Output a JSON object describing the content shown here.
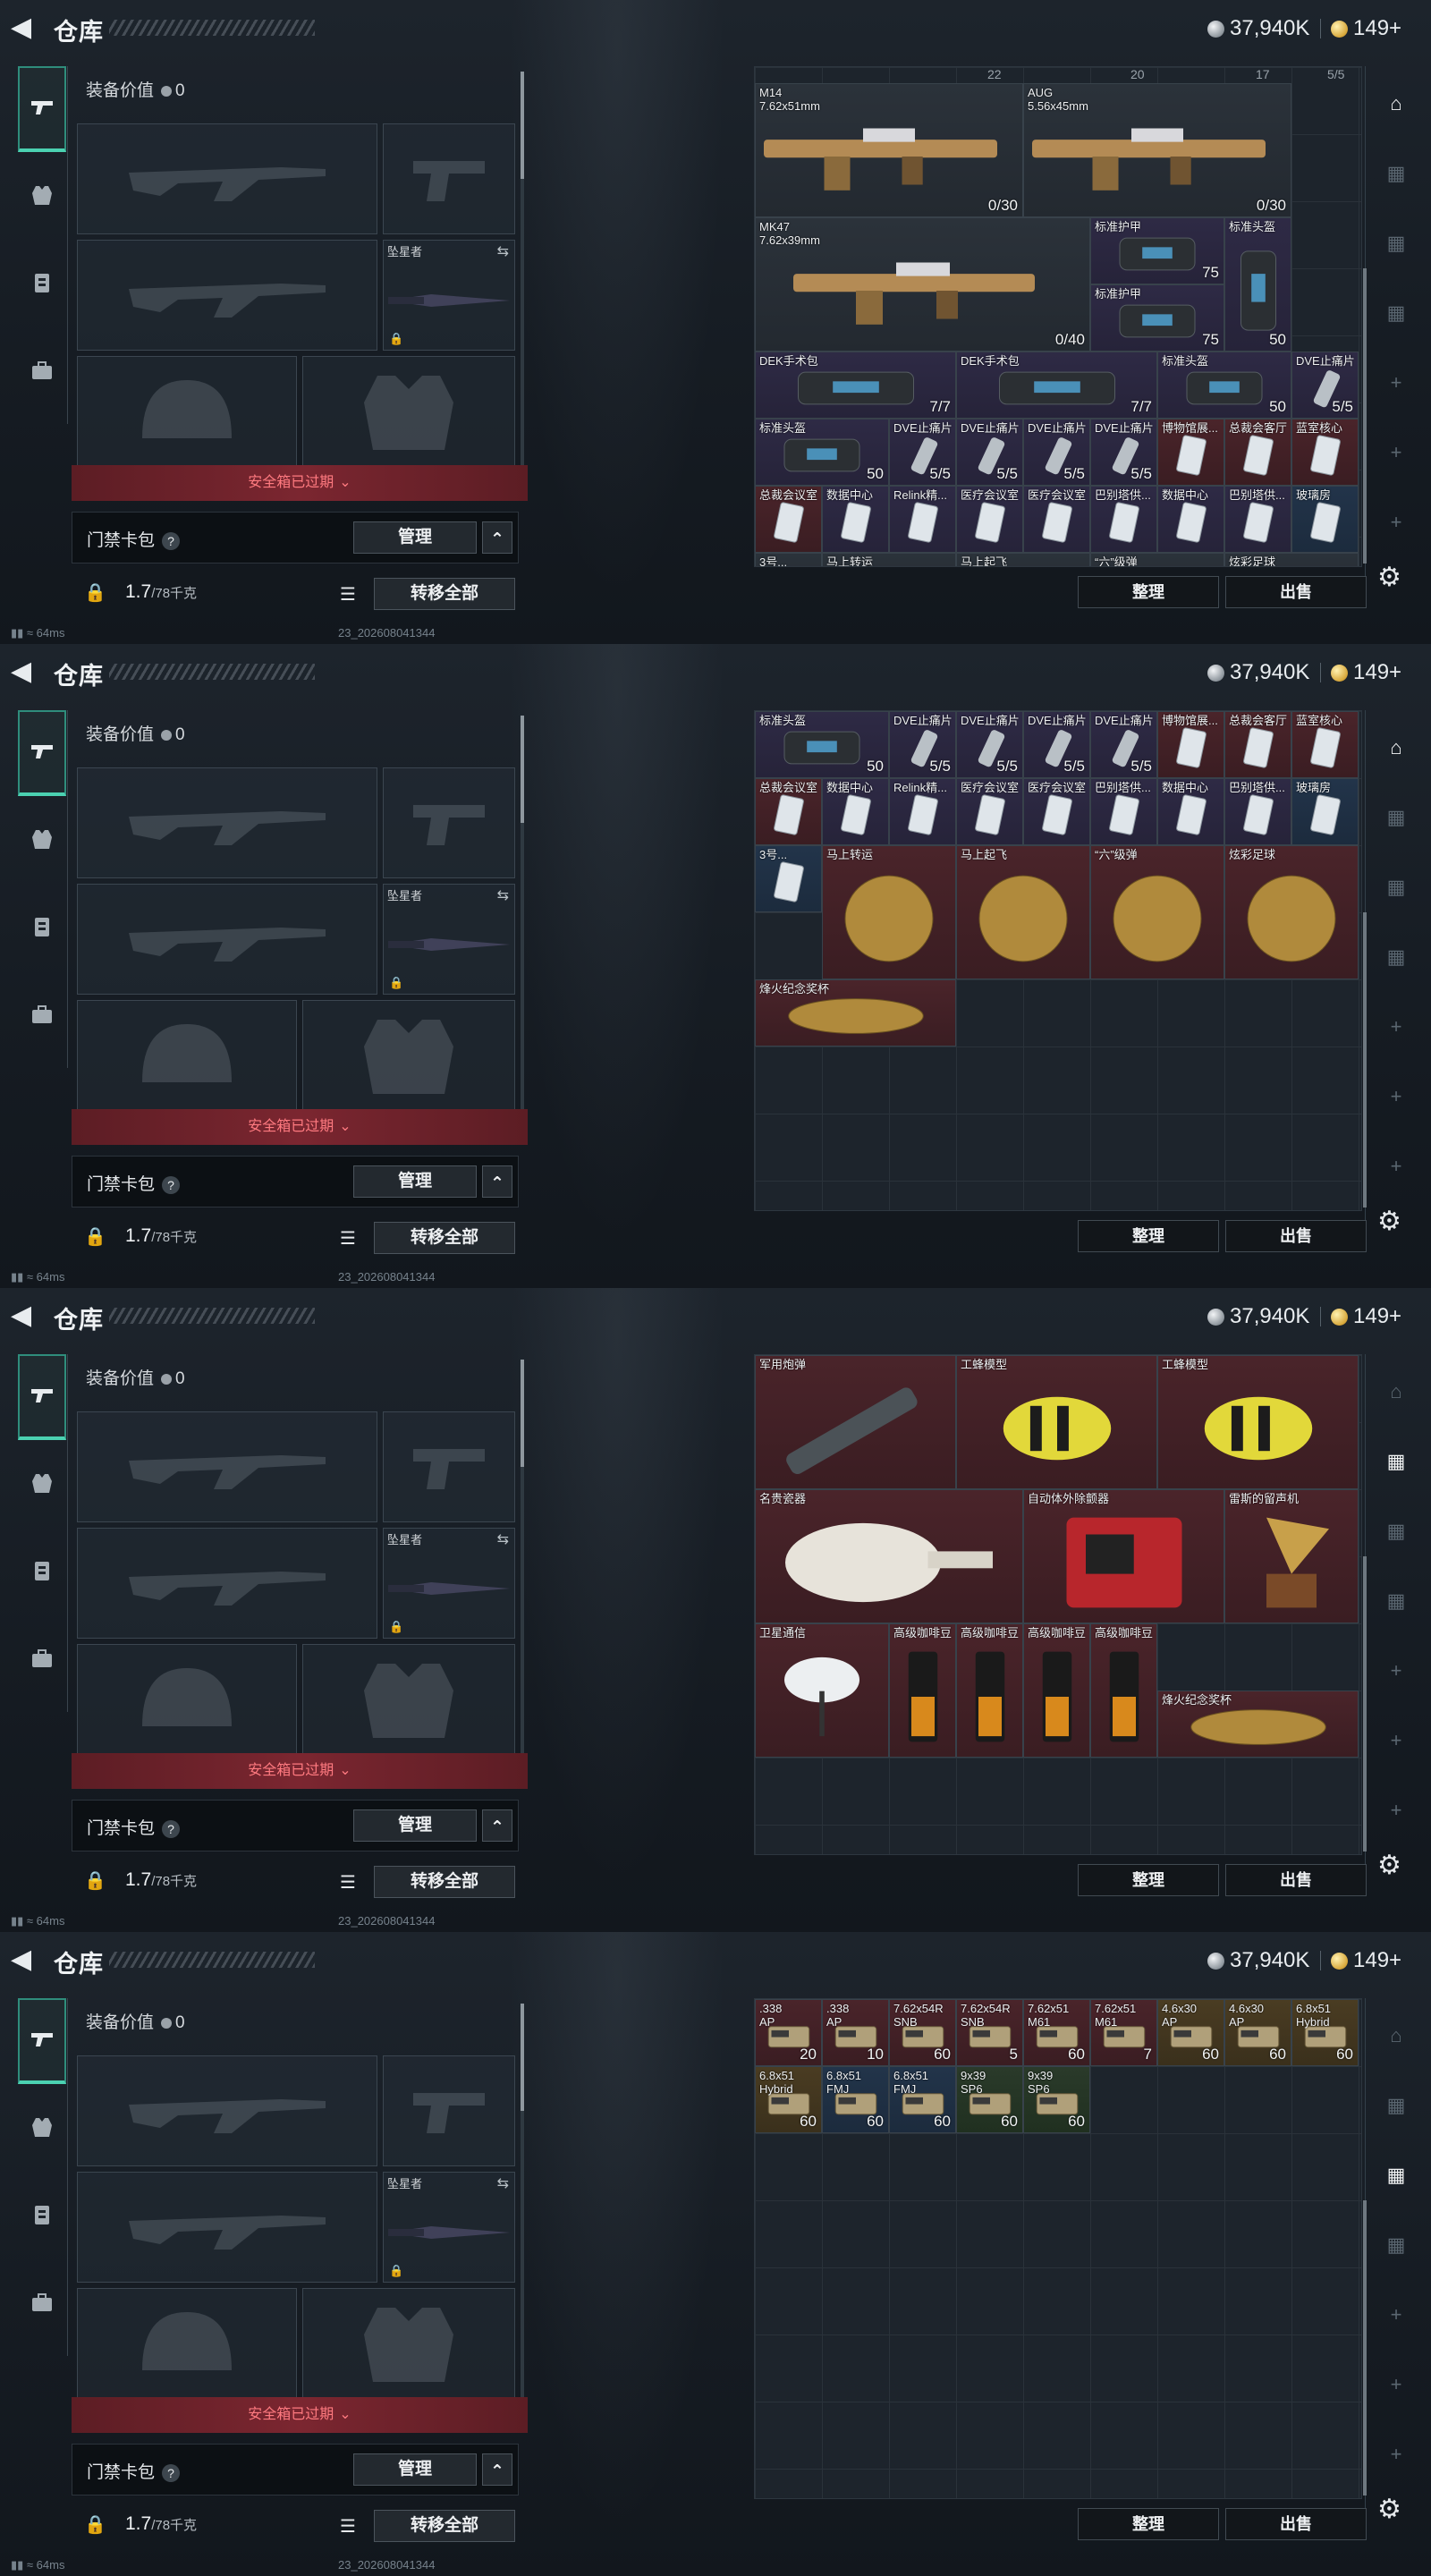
{
  "header": {
    "title": "仓库",
    "silver": "37,940K",
    "gold": "149+"
  },
  "left": {
    "equip_label": "装备价值",
    "equip_value": "0",
    "melee_label": "坠星者",
    "safe_box": "安全箱已过期",
    "keycard_label": "门禁卡包",
    "keycard_help": "?",
    "manage": "管理",
    "weight": "1.7",
    "weight_max": "/78千克",
    "transfer_all": "转移全部"
  },
  "status": {
    "ping": "64ms",
    "uid": "23_202608041344"
  },
  "grid_buttons": {
    "sort": "整理",
    "sell": "出售"
  },
  "panels": [
    {
      "top_counts": [
        "22",
        "20",
        "17",
        "5/5"
      ],
      "items": [
        {
          "name": "M14\n7.62x51mm",
          "count": "0/30",
          "c": "gray"
        },
        {
          "name": "AUG\n5.56x45mm",
          "count": "0/30",
          "c": "gray"
        },
        {
          "name": "MK47\n7.62x39mm",
          "count": "0/40",
          "c": "gray"
        },
        {
          "name": "标准护甲",
          "count": "75",
          "c": "purple"
        },
        {
          "name": "标准头盔",
          "count": "50",
          "c": "purple"
        },
        {
          "name": "标准护甲",
          "count": "75",
          "c": "purple"
        },
        {
          "name": "DEK手术包",
          "count": "7/7",
          "c": "purple"
        },
        {
          "name": "DEK手术包",
          "count": "7/7",
          "c": "purple"
        },
        {
          "name": "标准头盔",
          "count": "50",
          "c": "purple"
        },
        {
          "name": "DVE止痛片",
          "count": "5/5",
          "c": "purple"
        },
        {
          "name": "标准头盔",
          "count": "50",
          "c": "purple"
        },
        {
          "name": "DVE止痛片",
          "count": "5/5",
          "c": "purple"
        },
        {
          "name": "DVE止痛片",
          "count": "5/5",
          "c": "purple"
        },
        {
          "name": "DVE止痛片",
          "count": "5/5",
          "c": "purple"
        },
        {
          "name": "DVE止痛片",
          "count": "5/5",
          "c": "purple"
        },
        {
          "name": "博物馆展...",
          "count": "",
          "c": "red"
        },
        {
          "name": "总裁会客厅",
          "count": "",
          "c": "red"
        },
        {
          "name": "蓝室核心",
          "count": "",
          "c": "red"
        },
        {
          "name": "总裁会议室",
          "count": "",
          "c": "red"
        },
        {
          "name": "数据中心",
          "count": "",
          "c": "purple"
        },
        {
          "name": "Relink精...",
          "count": "",
          "c": "purple"
        },
        {
          "name": "医疗会议室",
          "count": "",
          "c": "purple"
        },
        {
          "name": "医疗会议室",
          "count": "",
          "c": "purple"
        },
        {
          "name": "巴别塔供...",
          "count": "",
          "c": "purple"
        },
        {
          "name": "数据中心",
          "count": "",
          "c": "purple"
        },
        {
          "name": "巴别塔供...",
          "count": "",
          "c": "purple"
        },
        {
          "name": "玻璃房",
          "count": "",
          "c": "blue"
        },
        {
          "name": "3号...",
          "count": "",
          "c": "gray"
        },
        {
          "name": "马上转运",
          "count": "",
          "c": "gray"
        },
        {
          "name": "马上起飞",
          "count": "",
          "c": "gray"
        },
        {
          "name": "“六”级弹",
          "count": "",
          "c": "gray"
        },
        {
          "name": "炫彩足球",
          "count": "",
          "c": "gray"
        }
      ]
    },
    {
      "items": [
        {
          "name": "标准头盔",
          "count": "50",
          "c": "purple"
        },
        {
          "name": "DVE止痛片",
          "count": "5/5",
          "c": "purple"
        },
        {
          "name": "DVE止痛片",
          "count": "5/5",
          "c": "purple"
        },
        {
          "name": "DVE止痛片",
          "count": "5/5",
          "c": "purple"
        },
        {
          "name": "DVE止痛片",
          "count": "5/5",
          "c": "purple"
        },
        {
          "name": "博物馆展...",
          "count": "",
          "c": "red"
        },
        {
          "name": "总裁会客厅",
          "count": "",
          "c": "red"
        },
        {
          "name": "蓝室核心",
          "count": "",
          "c": "red"
        },
        {
          "name": "总裁会议室",
          "count": "",
          "c": "red"
        },
        {
          "name": "数据中心",
          "count": "",
          "c": "purple"
        },
        {
          "name": "Relink精...",
          "count": "",
          "c": "purple"
        },
        {
          "name": "医疗会议室",
          "count": "",
          "c": "purple"
        },
        {
          "name": "医疗会议室",
          "count": "",
          "c": "purple"
        },
        {
          "name": "巴别塔供...",
          "count": "",
          "c": "purple"
        },
        {
          "name": "数据中心",
          "count": "",
          "c": "purple"
        },
        {
          "name": "巴别塔供...",
          "count": "",
          "c": "purple"
        },
        {
          "name": "玻璃房",
          "count": "",
          "c": "blue"
        },
        {
          "name": "3号...",
          "count": "",
          "c": "blue"
        },
        {
          "name": "马上转运",
          "count": "",
          "c": "red"
        },
        {
          "name": "马上起飞",
          "count": "",
          "c": "red"
        },
        {
          "name": "“六”级弹",
          "count": "",
          "c": "red"
        },
        {
          "name": "炫彩足球",
          "count": "",
          "c": "red"
        },
        {
          "name": "烽火纪念奖杯",
          "count": "",
          "c": "red"
        }
      ]
    },
    {
      "items": [
        {
          "name": "军用炮弹",
          "count": "",
          "c": "red"
        },
        {
          "name": "工蜂模型",
          "count": "",
          "c": "red"
        },
        {
          "name": "工蜂模型",
          "count": "",
          "c": "red"
        },
        {
          "name": "名贵瓷器",
          "count": "",
          "c": "red"
        },
        {
          "name": "自动体外除颤器",
          "count": "",
          "c": "red"
        },
        {
          "name": "雷斯的留声机",
          "count": "",
          "c": "red"
        },
        {
          "name": "卫星通信",
          "count": "",
          "c": "red"
        },
        {
          "name": "高级咖啡豆",
          "count": "",
          "c": "red"
        },
        {
          "name": "高级咖啡豆",
          "count": "",
          "c": "red"
        },
        {
          "name": "高级咖啡豆",
          "count": "",
          "c": "red"
        },
        {
          "name": "高级咖啡豆",
          "count": "",
          "c": "red"
        },
        {
          "name": "烽火纪念奖杯",
          "count": "",
          "c": "red"
        }
      ]
    },
    {
      "items": [
        {
          "name": ".338\nAP",
          "count": "20",
          "c": "red"
        },
        {
          "name": ".338\nAP",
          "count": "10",
          "c": "red"
        },
        {
          "name": "7.62x54R\nSNB",
          "count": "60",
          "c": "red"
        },
        {
          "name": "7.62x54R\nSNB",
          "count": "5",
          "c": "red"
        },
        {
          "name": "7.62x51\nM61",
          "count": "60",
          "c": "red"
        },
        {
          "name": "7.62x51\nM61",
          "count": "7",
          "c": "red"
        },
        {
          "name": "4.6x30\nAP",
          "count": "60",
          "c": "gold"
        },
        {
          "name": "4.6x30\nAP",
          "count": "60",
          "c": "gold"
        },
        {
          "name": "6.8x51\nHybrid",
          "count": "60",
          "c": "gold"
        },
        {
          "name": "6.8x51\nHybrid",
          "count": "60",
          "c": "gold"
        },
        {
          "name": "6.8x51\nFMJ",
          "count": "60",
          "c": "blue"
        },
        {
          "name": "6.8x51\nFMJ",
          "count": "60",
          "c": "blue"
        },
        {
          "name": "9x39\nSP6",
          "count": "60",
          "c": "green"
        },
        {
          "name": "9x39\nSP6",
          "count": "60",
          "c": "green"
        }
      ]
    }
  ]
}
